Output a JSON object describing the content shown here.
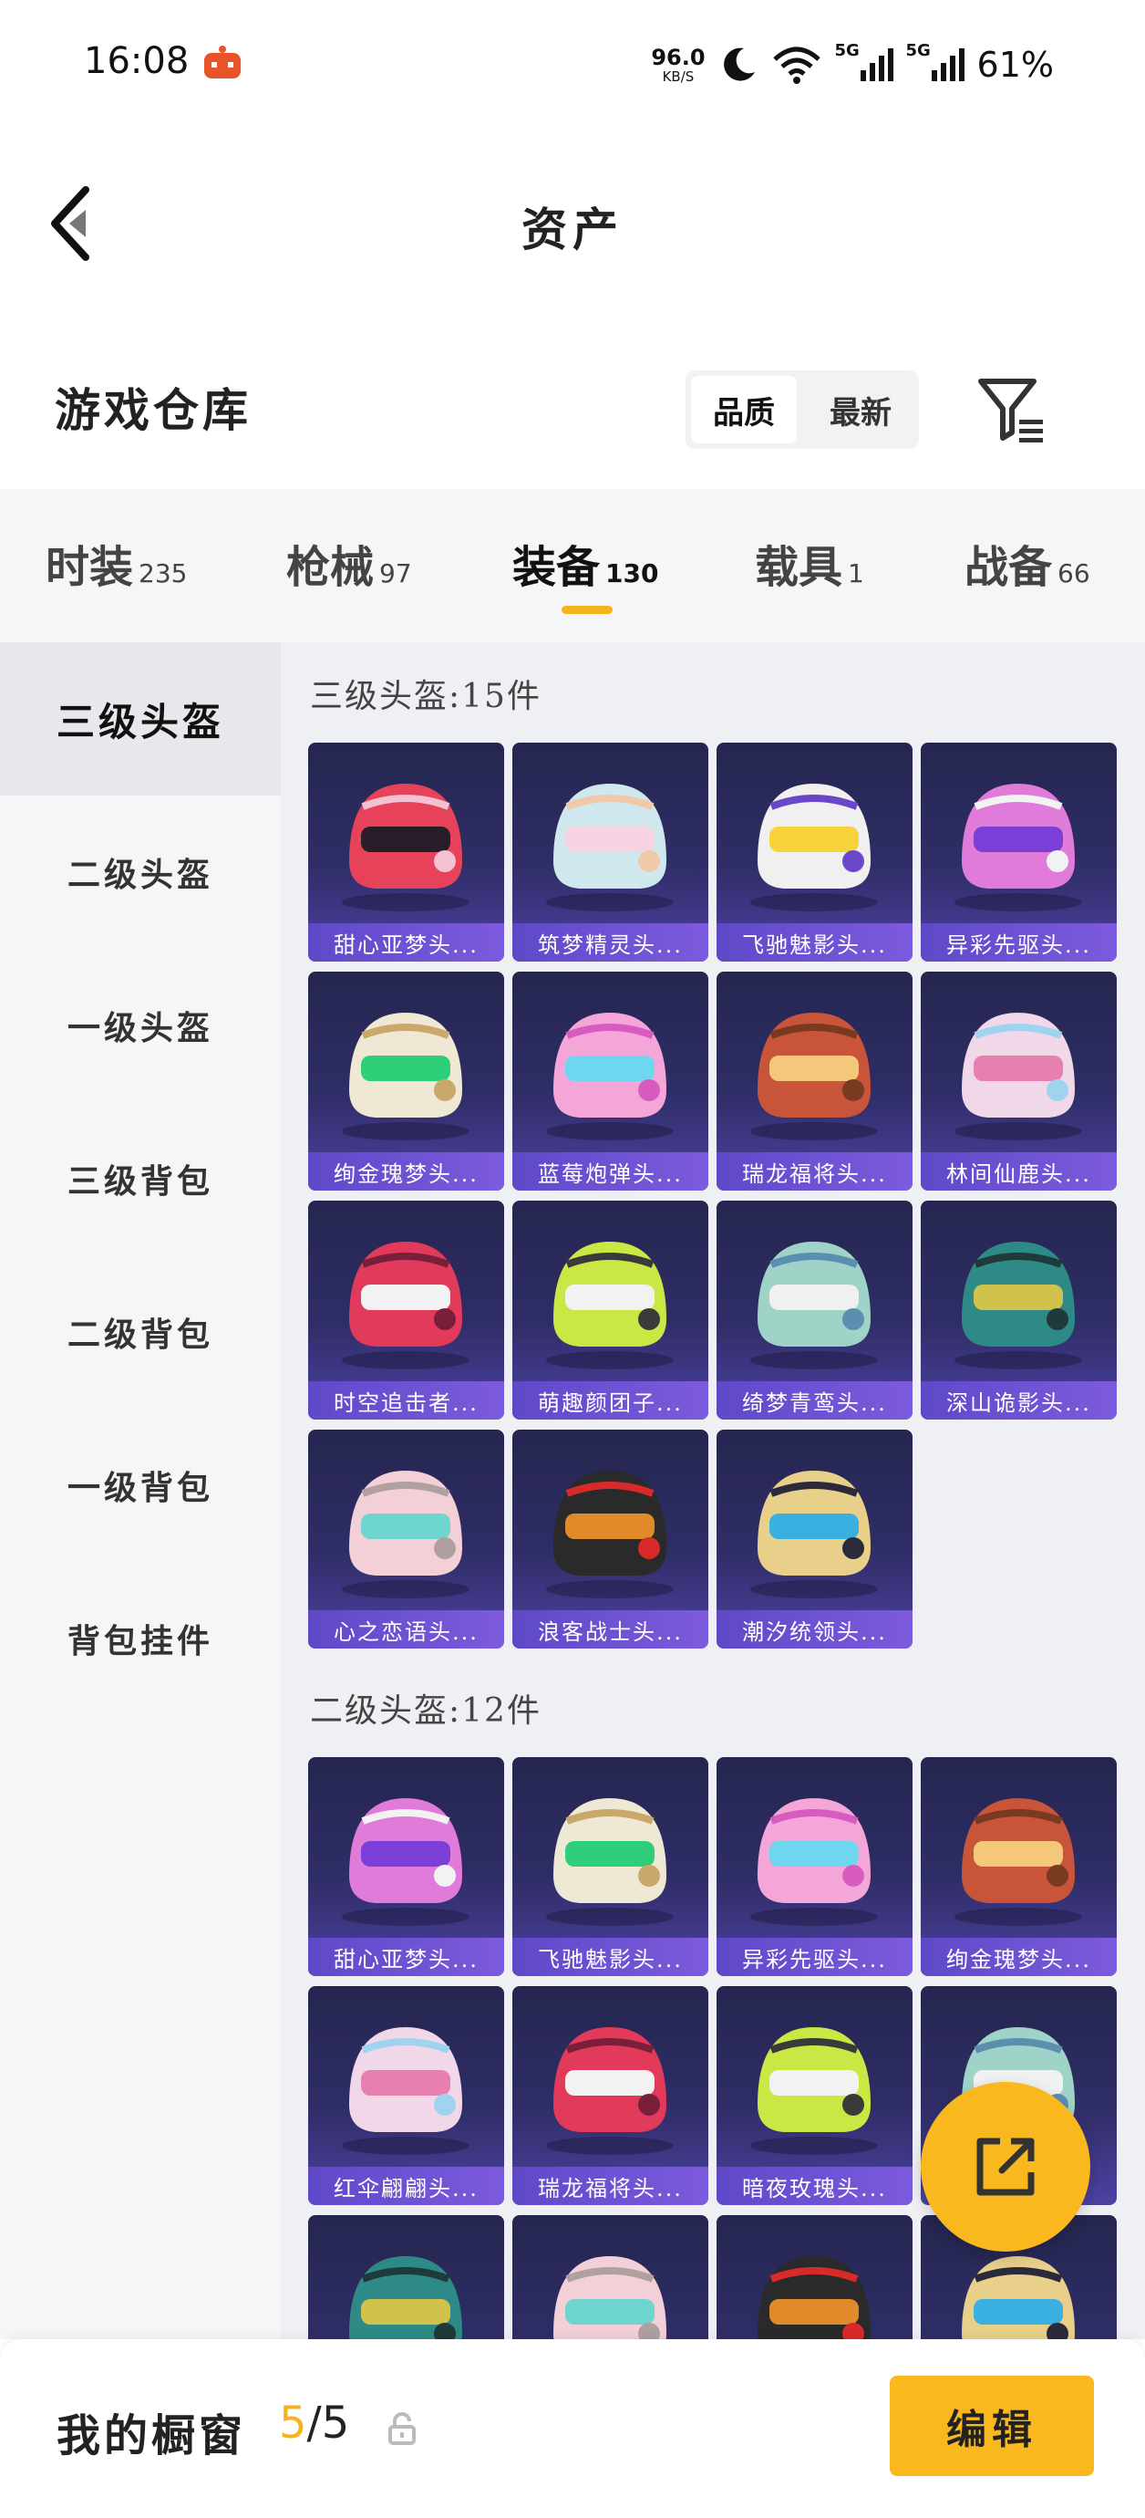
{
  "status_bar": {
    "time": "16:08",
    "speed_value": "96.0",
    "speed_unit": "KB/S",
    "network_1": "5G",
    "network_2": "5G",
    "battery": "61%"
  },
  "header": {
    "title": "资产",
    "back_icon": "chevron-left-icon"
  },
  "warehouse": {
    "title": "游戏仓库",
    "sort_options": [
      "品质",
      "最新"
    ],
    "sort_selected": "品质",
    "filter_icon": "filter-icon"
  },
  "tabs": [
    {
      "label": "时装",
      "count": "235"
    },
    {
      "label": "枪械",
      "count": "97"
    },
    {
      "label": "装备",
      "count": "130",
      "active": true
    },
    {
      "label": "载具",
      "count": "1"
    },
    {
      "label": "战备",
      "count": "66"
    }
  ],
  "sidebar": {
    "items": [
      "三级头盔",
      "二级头盔",
      "一级头盔",
      "三级背包",
      "二级背包",
      "一级背包",
      "背包挂件"
    ],
    "active": "三级头盔"
  },
  "sections": [
    {
      "heading": "三级头盔:15件",
      "items": [
        "甜心亚梦头...",
        "筑梦精灵头...",
        "飞驰魅影头...",
        "异彩先驱头...",
        "绚金瑰梦头...",
        "蓝莓炮弹头...",
        "瑞龙福将头...",
        "林间仙鹿头...",
        "时空追击者...",
        "萌趣颜团子...",
        "绮梦青鸾头...",
        "深山诡影头...",
        "心之恋语头...",
        "浪客战士头...",
        "潮汐统领头..."
      ]
    },
    {
      "heading": "二级头盔:12件",
      "items": [
        "甜心亚梦头...",
        "飞驰魅影头...",
        "异彩先驱头...",
        "绚金瑰梦头...",
        "红伞翩翩头...",
        "瑞龙福将头...",
        "暗夜玫瑰头...",
        "",
        "",
        "",
        "",
        ""
      ]
    }
  ],
  "fab": {
    "icon": "share-external-icon"
  },
  "bottom_bar": {
    "label": "我的橱窗",
    "current": "5",
    "separator": "/",
    "total": "5",
    "lock_icon": "lock-icon",
    "edit_label": "编辑"
  },
  "colors": {
    "accent": "#f9b81e",
    "card_label_bg": "#6a4fd0",
    "card_bg": "#2a2a5a"
  }
}
